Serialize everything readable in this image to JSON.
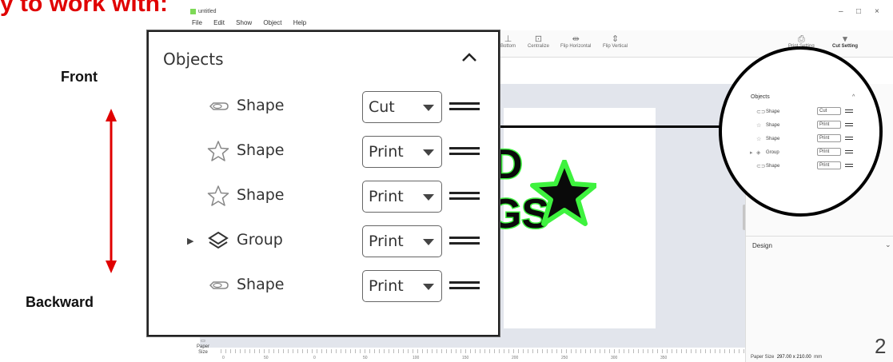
{
  "slide": {
    "title": "y to work with:",
    "page_number": "2",
    "label_front": "Front",
    "label_backward": "Backward"
  },
  "app": {
    "window_title": "untitled",
    "menu": [
      "File",
      "Edit",
      "Show",
      "Object",
      "Help"
    ],
    "toolbar": [
      "Bottom",
      "Centralize",
      "Flip Horizontal",
      "Flip Vertical"
    ],
    "print_setting": "Print Setting",
    "cut_setting": "Cut Setting",
    "paper_size_button": "Paper\nSize",
    "status_label": "Paper Size",
    "status_value": "297.00 x 210.00",
    "status_unit": "mm",
    "design_header": "Design",
    "ruler_ticks": [
      "0",
      "50",
      "0",
      "50",
      "100",
      "150",
      "200",
      "250",
      "300",
      "350"
    ],
    "artwork_text_top": "D",
    "artwork_text_bottom": "GS"
  },
  "objects_panel": {
    "header": "Objects",
    "rows": [
      {
        "icon": "outline-shape-icon",
        "label": "Shape",
        "type": "Cut",
        "expandable": false
      },
      {
        "icon": "star-icon",
        "label": "Shape",
        "type": "Print",
        "expandable": false
      },
      {
        "icon": "star-icon",
        "label": "Shape",
        "type": "Print",
        "expandable": false
      },
      {
        "icon": "layers-icon",
        "label": "Group",
        "type": "Print",
        "expandable": true
      },
      {
        "icon": "outline-shape-icon",
        "label": "Shape",
        "type": "Print",
        "expandable": false
      }
    ]
  },
  "colors": {
    "accent_red": "#e00000",
    "sticker_green": "#3ef23e"
  }
}
